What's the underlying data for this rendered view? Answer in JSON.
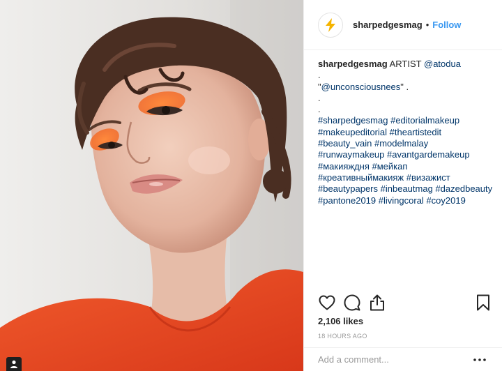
{
  "header": {
    "username": "sharpedgesmag",
    "separator": "•",
    "follow_label": "Follow"
  },
  "caption": {
    "username": "sharpedgesmag",
    "artist_prefix": "ARTIST",
    "artist_handle": "@atodua",
    "line_dot_1": ".",
    "credit_open": "\"",
    "credit_handle": "@unconsciousnees",
    "credit_close": "\" .",
    "line_dot_2": ".",
    "line_dot_3": ".",
    "hashtag_lines": [
      [
        "#sharpedgesmag",
        "#editorialmakeup"
      ],
      [
        "#makeupeditorial",
        "#theartistedit"
      ],
      [
        "#beauty_vain",
        "#modelmalay"
      ],
      [
        "#runwaymakeup",
        "#avantgardemakeup"
      ],
      [
        "#макияждня",
        "#мейкап"
      ],
      [
        "#креативныймакияж",
        "#визажист"
      ],
      [
        "#beautypapers",
        "#inbeautmag",
        "#dazedbeauty"
      ],
      [
        "#pantone2019",
        "#livingcoral",
        "#coy2019"
      ]
    ]
  },
  "actions": {
    "like_icon": "heart-outline-icon",
    "comment_icon": "comment-bubble-icon",
    "share_icon": "share-upload-icon",
    "save_icon": "bookmark-icon"
  },
  "likes_text": "2,106 likes",
  "timestamp": "18 HOURS AGO",
  "comment": {
    "placeholder": "Add a comment...",
    "more_icon": "more-dots-icon"
  },
  "colors": {
    "follow": "#3897f0",
    "link": "#003569",
    "muted": "#999999",
    "logo": "#f5b400",
    "jacket": "#e8431f"
  }
}
